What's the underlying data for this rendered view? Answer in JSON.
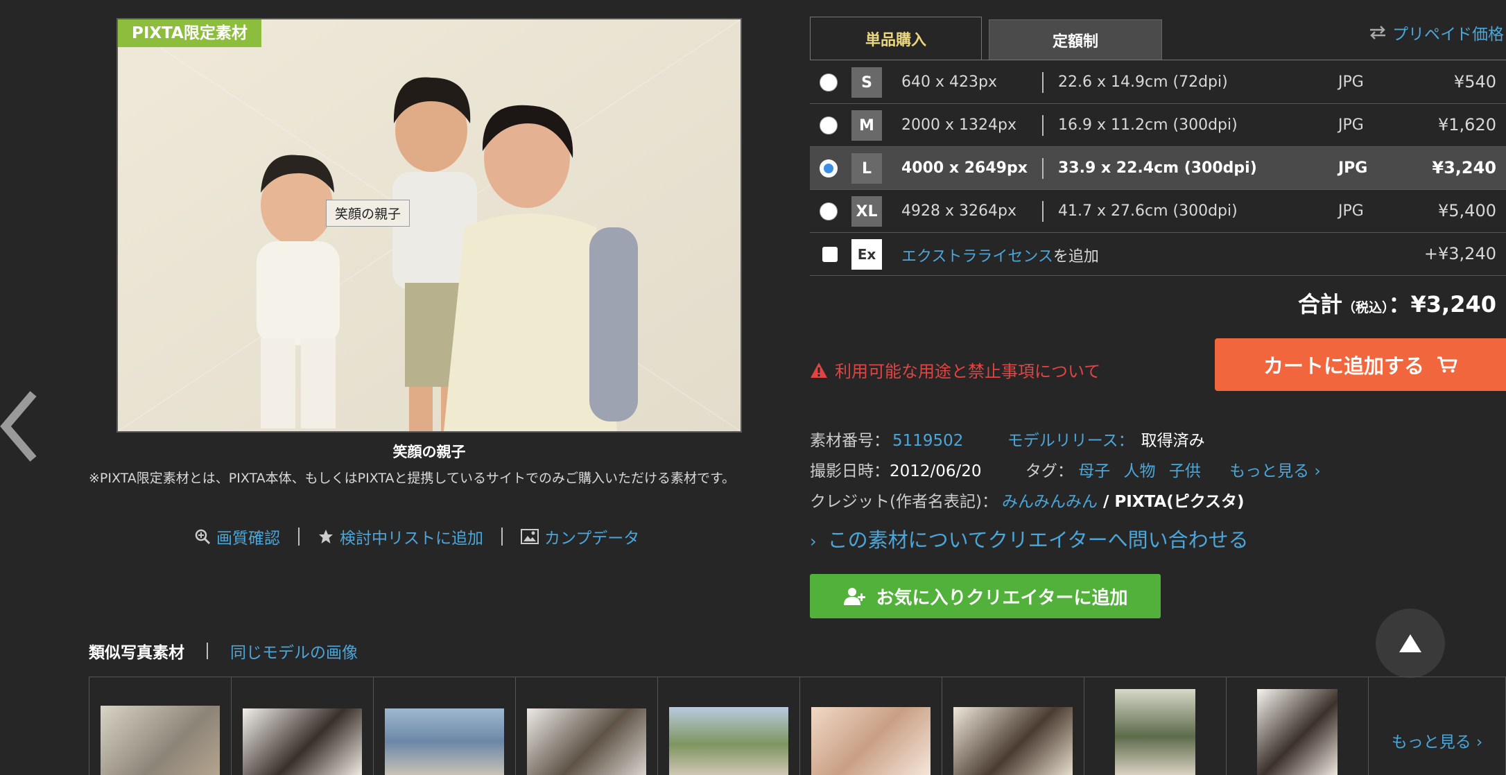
{
  "photo": {
    "badge": "PIXTA限定素材",
    "tooltip": "笑顔の親子",
    "caption": "笑顔の親子",
    "notice": "※PIXTA限定素材とは、PIXTA本体、もしくはPIXTAと提携しているサイトでのみご購入いただける素材です。"
  },
  "tools": {
    "quality": "画質確認",
    "wishlist": "検討中リストに追加",
    "comp": "カンプデータ"
  },
  "tabs": {
    "single": "単品購入",
    "subscription": "定額制",
    "prepaid": "プリペイド価格"
  },
  "sizes": [
    {
      "code": "S",
      "px": "640 x 423px",
      "cm": "22.6 x 14.9cm (72dpi)",
      "format": "JPG",
      "price": "¥540",
      "selected": false
    },
    {
      "code": "M",
      "px": "2000 x 1324px",
      "cm": "16.9 x 11.2cm (300dpi)",
      "format": "JPG",
      "price": "¥1,620",
      "selected": false
    },
    {
      "code": "L",
      "px": "4000 x 2649px",
      "cm": "33.9 x 22.4cm (300dpi)",
      "format": "JPG",
      "price": "¥3,240",
      "selected": true
    },
    {
      "code": "XL",
      "px": "4928 x 3264px",
      "cm": "41.7 x 27.6cm (300dpi)",
      "format": "JPG",
      "price": "¥5,400",
      "selected": false
    }
  ],
  "extra": {
    "code": "Ex",
    "link": "エクストラライセンス",
    "suffix": "を追加",
    "price": "+¥3,240"
  },
  "total": {
    "label": "合計",
    "tax": "（税込）",
    "colon": "：",
    "value": "¥3,240"
  },
  "warning": "利用可能な用途と禁止事項について",
  "cart": "カートに追加する",
  "meta": {
    "id_label": "素材番号：",
    "id": "5119502",
    "release_label": "モデルリリース：",
    "release": "取得済み",
    "date_label": "撮影日時：",
    "date": "2012/06/20",
    "tag_label": "タグ：",
    "tags": [
      "母子",
      "人物",
      "子供"
    ],
    "more": "もっと見る ›",
    "credit_label": "クレジット(作者名表記)：",
    "credit_author": "みんみんみん",
    "credit_suffix": " / PIXTA(ピクスタ)"
  },
  "inquiry": "この素材についてクリエイターへ問い合わせる",
  "fav": "お気に入りクリエイターに追加",
  "similar": {
    "tab1": "類似写真素材",
    "tab2": "同じモデルの画像",
    "more": "もっと見る ›"
  },
  "colors": {
    "accent": "#4ba6d9",
    "cart": "#f2663d",
    "fav": "#52b13a",
    "badge": "#8dbd3c",
    "warn": "#e24343"
  }
}
